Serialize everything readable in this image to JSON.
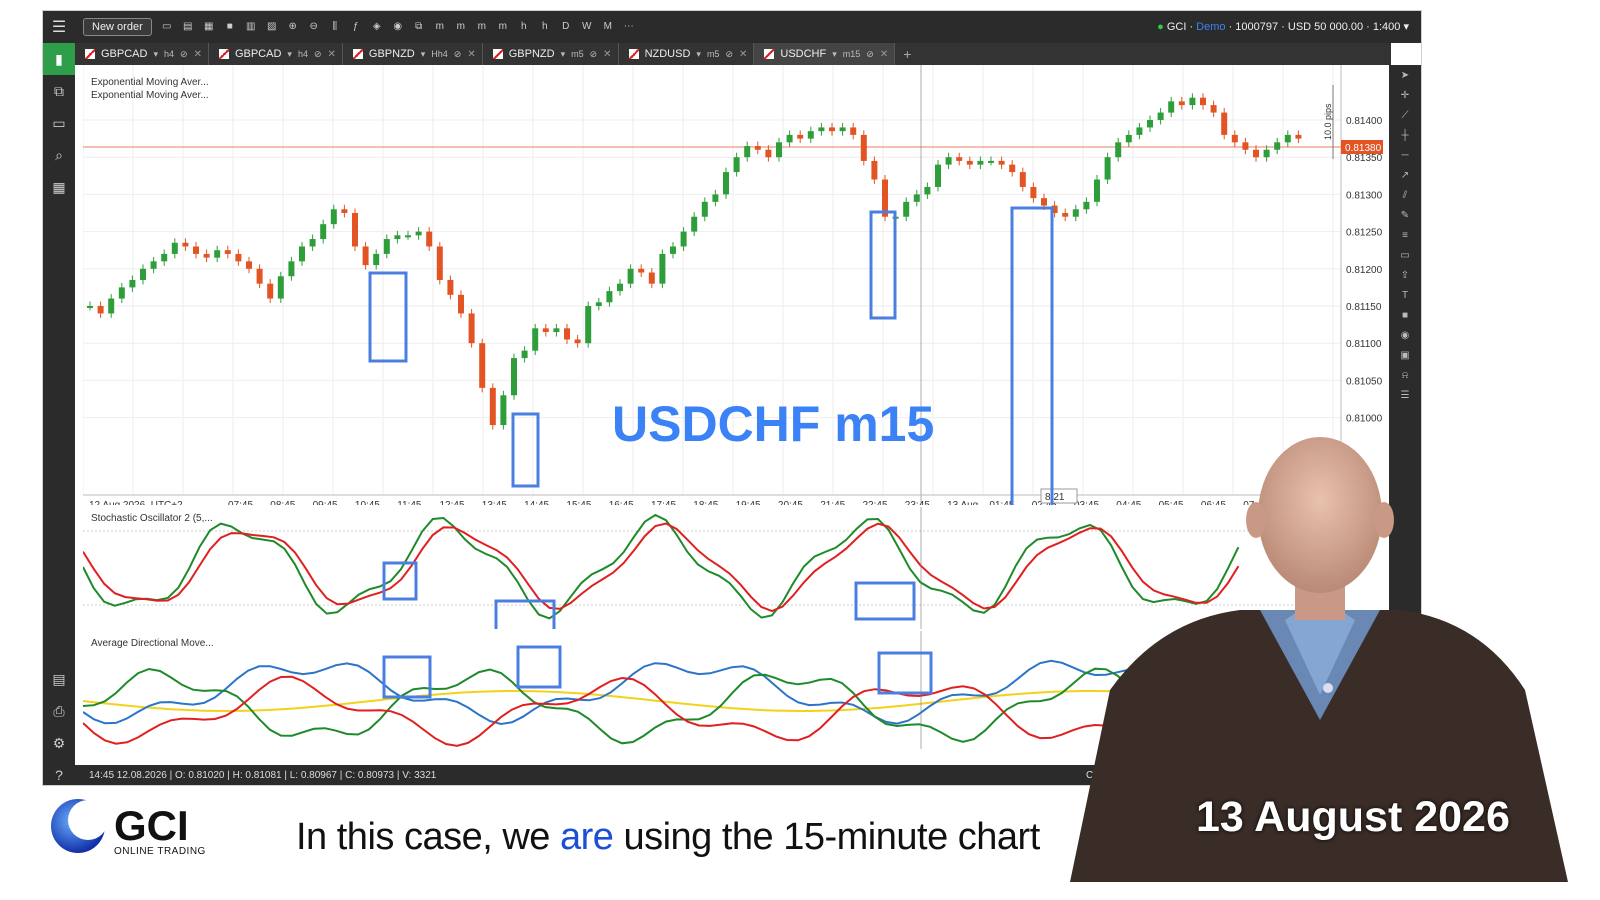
{
  "app": {
    "new_order": "New order",
    "account": "GCI · ",
    "account_demo": "Demo",
    "account_rest": " · 1000797 · USD 50 000.00 · 1:400"
  },
  "tabs": [
    {
      "symbol": "GBPCAD",
      "tf": "h4",
      "active": false
    },
    {
      "symbol": "GBPCAD",
      "tf": "h4",
      "active": false
    },
    {
      "symbol": "GBPNZD",
      "tf": "Hh4",
      "active": false
    },
    {
      "symbol": "GBPNZD",
      "tf": "m5",
      "active": false
    },
    {
      "symbol": "NZDUSD",
      "tf": "m5",
      "active": false
    },
    {
      "symbol": "USDCHF",
      "tf": "m15",
      "active": true
    }
  ],
  "main": {
    "legend1": "Exponential Moving Aver...",
    "legend2": "Exponential Moving Aver...",
    "pips": "10.0 pips",
    "current_price": "0.81380",
    "overlay_title": "USDCHF m15",
    "cursor_time": "8:21",
    "y_ticks": [
      "0.81400",
      "0.81350",
      "0.81300",
      "0.81250",
      "0.81200",
      "0.81150",
      "0.81100",
      "0.81050",
      "0.81000"
    ],
    "x_start": "12 Aug 2026, UTC+2",
    "x_ticks": [
      "07:45",
      "08:45",
      "09:45",
      "10:45",
      "11:45",
      "12:45",
      "13:45",
      "14:45",
      "15:45",
      "16:45",
      "17:45",
      "18:45",
      "19:45",
      "20:45",
      "21:45",
      "22:45",
      "23:45",
      "13 Aug",
      "01:45",
      "02:45",
      "03:45",
      "04:45",
      "05:45",
      "06:45",
      "07:45"
    ]
  },
  "indicator1": {
    "label": "Stochastic Oscillator 2 (5,..."
  },
  "indicator2": {
    "label": "Average Directional Move..."
  },
  "status": {
    "ohlc": "14:45 12.08.2026 | O: 0.81020 | H: 0.81081 | L: 0.80967 | C: 0.80973 | V: 3321",
    "currency": "Curren"
  },
  "branding": {
    "logo": "GCI",
    "tagline": "ONLINE TRADING",
    "caption_pre": "In this case, we ",
    "caption_hl": "are",
    "caption_post": " using the 15-minute chart",
    "date": "13 August 2026"
  },
  "colors": {
    "bull": "#2e9e3a",
    "bear": "#e25424",
    "price_line": "#e25424",
    "highlight": "#4a7fe0",
    "stoch_k": "#1e8a2a",
    "stoch_d": "#e02020",
    "adx_blue": "#2b74c8",
    "adx_yellow": "#f2d21b"
  },
  "icons": [
    "hamburger-icon",
    "chart-icon",
    "copy-icon",
    "wallet-icon",
    "search-icon",
    "layout-icon",
    "calculator-icon",
    "printer-icon",
    "settings-icon",
    "help-icon",
    "cursor-icon",
    "crosshair-icon",
    "trendline-icon",
    "text-icon",
    "alarm-icon"
  ]
}
